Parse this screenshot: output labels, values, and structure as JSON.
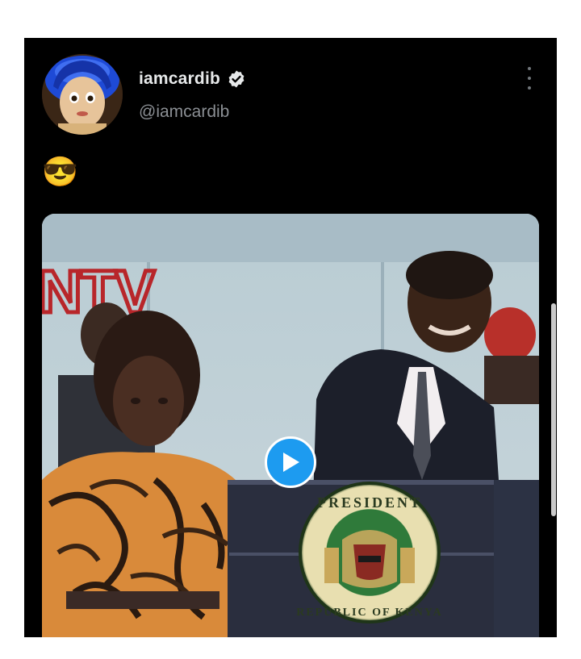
{
  "post": {
    "display_name": "iamcardib",
    "handle": "@iamcardib",
    "verified": true,
    "text": "😎",
    "more_icon": "more-vertical-icon"
  },
  "media": {
    "type": "video",
    "overlay_letters": "NTV",
    "seal_text": "PRESIDENT · REPUBLIC OF KENYA",
    "play_icon": "play-icon"
  },
  "colors": {
    "card_background": "#000000",
    "page_background": "#ffffff",
    "name": "#e7e9ea",
    "handle": "#8b8f94",
    "accent": "#1d9bf0"
  }
}
